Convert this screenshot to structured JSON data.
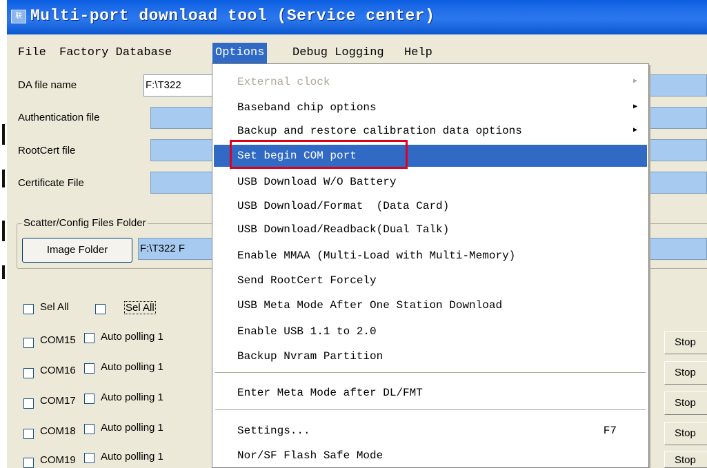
{
  "window": {
    "title": "Multi-port download tool (Service center)",
    "icon_text": "联"
  },
  "menubar": {
    "file": "File",
    "factory_database": "Factory Database",
    "options": "Options",
    "debug_logging": "Debug Logging",
    "help": "Help"
  },
  "form": {
    "da_file_label": "DA file name",
    "da_file_value": "F:\\T322",
    "auth_file_label": "Authentication file",
    "auth_file_value": "",
    "rootcert_label": "RootCert file",
    "rootcert_value": "",
    "certificate_label": "Certificate File",
    "certificate_value": "",
    "scatter_group_title": "Scatter/Config Files Folder",
    "image_folder_button": "Image Folder",
    "image_folder_value": "F:\\T322 F"
  },
  "selection": {
    "sel_all_1": "Sel All",
    "sel_all_2": "Sel All"
  },
  "ports": [
    {
      "com": "COM15",
      "polling": "Auto polling 1",
      "stop": "Stop"
    },
    {
      "com": "COM16",
      "polling": "Auto polling 1",
      "stop": "Stop"
    },
    {
      "com": "COM17",
      "polling": "Auto polling 1",
      "stop": "Stop"
    },
    {
      "com": "COM18",
      "polling": "Auto polling 1",
      "stop": "Stop"
    },
    {
      "com": "COM19",
      "polling": "Auto polling 1",
      "stop": "Stop"
    }
  ],
  "options_menu": {
    "external_clock": "External clock",
    "baseband_chip": "Baseband chip options",
    "backup_restore": "Backup and restore calibration data options",
    "set_begin_com": "Set begin COM port",
    "usb_download_wo_battery": "USB Download W/O Battery",
    "usb_download_format": "USB Download/Format  (Data Card)",
    "usb_download_readback": "USB Download/Readback(Dual Talk)",
    "enable_mmaa": "Enable MMAA (Multi-Load with Multi-Memory)",
    "send_rootcert": "Send RootCert Forcely",
    "usb_meta_mode": "USB Meta Mode After One Station Download",
    "enable_usb11": "Enable USB 1.1 to 2.0",
    "backup_nvram": "Backup Nvram Partition",
    "enter_meta_mode": "Enter Meta Mode after DL/FMT",
    "settings": "Settings...",
    "settings_shortcut": "F7",
    "nor_sf_flash": "Nor/SF Flash Safe Mode"
  },
  "colors": {
    "titlebar": "#0b5ad8",
    "menu_highlight": "#316ac5",
    "textbox_fill": "#a6caf0",
    "window_bg": "#ece9d8",
    "annotation_red": "#e0001a"
  }
}
